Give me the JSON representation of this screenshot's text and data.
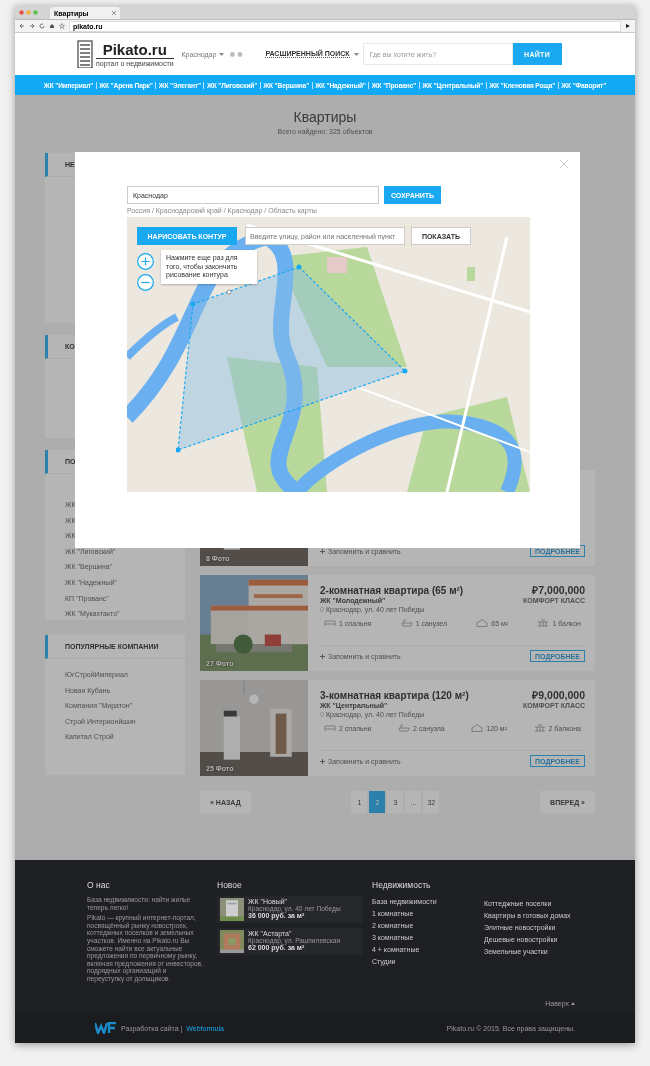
{
  "browser": {
    "tab": "Квартиры",
    "url": "pikato.ru"
  },
  "header": {
    "logo": "Pikato.ru",
    "tagline": "портал о недвижимости",
    "city": "Краснодар",
    "advanced_search": "РАСШИРЕННЫЙ ПОИСК",
    "search": {
      "placeholder": "Где вы хотите жить?"
    },
    "search_button": "НАЙТИ"
  },
  "nav": [
    "ЖК \"Империал\"",
    "ЖК \"Арена Парк\"",
    "ЖК \"Элегант\"",
    "ЖК \"Лиговский\"",
    "ЖК \"Вершина\"",
    "ЖК \"Надежный\"",
    "ЖК \"Прованс\"",
    "ЖК \"Центральный\"",
    "ЖК \"Кленовая Роща\"",
    "ЖК \"Фаворит\""
  ],
  "page": {
    "title": "Квартиры",
    "found": "Всего найдено: 325 объектов"
  },
  "sidebar": [
    {
      "heading": "НЕ"
    },
    {
      "heading": "КО"
    },
    {
      "heading": "ПО",
      "items": [
        "ЖК",
        "ЖК",
        "ЖК",
        "ЖК \"Лиговский\"",
        "ЖК \"Вершина\"",
        "ЖК \"Надежный\"",
        "КП \"Прованс\"",
        "ЖК \"Мукахтакто\""
      ]
    },
    {
      "heading": "ПОПУЛЯРНЫЕ КОМПАНИИ",
      "items": [
        "ЮгСтройИмпериал",
        "Новая Кубань",
        "Компания \"Миратон\"",
        "Строй Интерионйшин",
        "Капитал Строй"
      ]
    }
  ],
  "listings": [
    {
      "photos": "8 Фото",
      "compare": "Запомнить и сравнить",
      "details": "ПОДРОБНЕЕ"
    },
    {
      "title": "2-комнатная квартира (65 м²)",
      "complex": "ЖК \"Молодежный\"",
      "address": "Краснодар, ул. 40 лет Победы",
      "price": "₽7,000,000",
      "class": "КОМФОРТ КЛАСС",
      "features": [
        {
          "kind": "bedroom",
          "text": "1 спальня"
        },
        {
          "kind": "bathroom",
          "text": "1 санузел"
        },
        {
          "kind": "area",
          "text": "65 м²"
        },
        {
          "kind": "balcony",
          "text": "1 балкон"
        }
      ],
      "photos": "27 Фото",
      "compare": "Запомнить и сравнить",
      "details": "ПОДРОБНЕЕ"
    },
    {
      "title": "3-комнатная квартира (120 м²)",
      "complex": "ЖК \"Центральный\"",
      "address": "Краснодар, ул. 40 лет Победы",
      "price": "₽9,000,000",
      "class": "КОМФОРТ КЛАСС",
      "features": [
        {
          "kind": "bedroom",
          "text": "2 спальни"
        },
        {
          "kind": "bathroom",
          "text": "2 санузла"
        },
        {
          "kind": "area",
          "text": "120 м²"
        },
        {
          "kind": "balcony",
          "text": "2 балкона"
        }
      ],
      "photos": "25 Фото",
      "compare": "Запомнить и сравнить",
      "details": "ПОДРОБНЕЕ"
    }
  ],
  "pagination": {
    "prev": "« НАЗАД",
    "pages": [
      {
        "label": "1",
        "selected": false
      },
      {
        "label": "2",
        "selected": true
      },
      {
        "label": "3",
        "selected": false
      },
      {
        "label": "...",
        "selected": false
      },
      {
        "label": "32",
        "selected": false
      }
    ],
    "next": "ВПЕРЕД »"
  },
  "modal": {
    "city": {
      "value": "Краснодар"
    },
    "save": "СОХРАНИТЬ",
    "breadcrumbs": "Россия / Краснодарский край / Краснодар / Область карты",
    "map": {
      "draw_button": "НАРИСОВАТЬ КОНТУР",
      "search": {
        "placeholder": "Введите улицу, район или населенный пункт"
      },
      "show_button": "ПОКАЗАТЬ",
      "hint": "Нажмите еще раз для того, чтобы закончить рисование контура"
    }
  },
  "footer": {
    "about": {
      "heading": "О нас",
      "paragraphs": [
        "База недвижимости: найти жилье теперь легко!",
        "Pikato — крупный интернет-портал, посвящённый рынку новостроек, коттеджных поселков и земельных участков. Именно на Pikato.ru Вы сможете найти все актуальные предложения по первичному рынку, включая предложения от инвесторов, подрядных организаций и переуступку от дольщиков."
      ]
    },
    "new": {
      "heading": "Новое",
      "items": [
        {
          "title": "ЖК \"Новый\"",
          "address": "Краснодар, ул. 40 лет Победы",
          "price": "36 000 руб. за м²"
        },
        {
          "title": "ЖК \"Астарта\"",
          "address": "Краснодар, ул. Рашпилевская",
          "price": "62 000 руб. за м²"
        }
      ]
    },
    "realty": {
      "heading": "Недвижимость",
      "links": [
        "База недвижимости",
        "1 комнатные",
        "2 комнатные",
        "3 комнатные",
        "4 + комнатные",
        "Студии"
      ],
      "links_2": [
        "Коттеджные поселки",
        "Квартиры в готовых домах",
        "Элитные новостройки",
        "Дешевые новостройки",
        "Земельные участки"
      ]
    },
    "to_top": "Наверх",
    "developer": {
      "label": "Разработка сайта |",
      "link": "Webformula"
    },
    "copyright": "Pikato.ru © 2015. Все права защищены."
  }
}
